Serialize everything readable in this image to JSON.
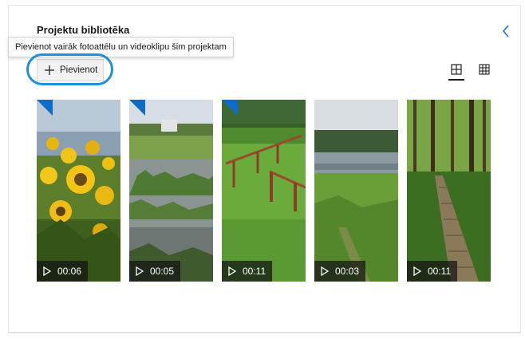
{
  "panel": {
    "title": "Projektu bibliotēka",
    "tooltip": "Pievienot vairāk fotoattēlu un videoklipu šim projektam",
    "add_button_label": "Pievienot"
  },
  "colors": {
    "accent": "#1e90d8",
    "badge": "#0b6dc7"
  },
  "icons": {
    "collapse": "chevron-left-icon",
    "add": "plus-icon",
    "view_large": "large-grid-icon",
    "view_small": "small-grid-icon",
    "play": "play-icon"
  },
  "media": [
    {
      "duration": "00:06",
      "scene": "sunflowers",
      "added_badge": true
    },
    {
      "duration": "00:05",
      "scene": "pond",
      "added_badge": true
    },
    {
      "duration": "00:11",
      "scene": "meadow-fence",
      "added_badge": true
    },
    {
      "duration": "00:03",
      "scene": "river",
      "added_badge": false
    },
    {
      "duration": "00:11",
      "scene": "forest-path",
      "added_badge": false
    }
  ]
}
